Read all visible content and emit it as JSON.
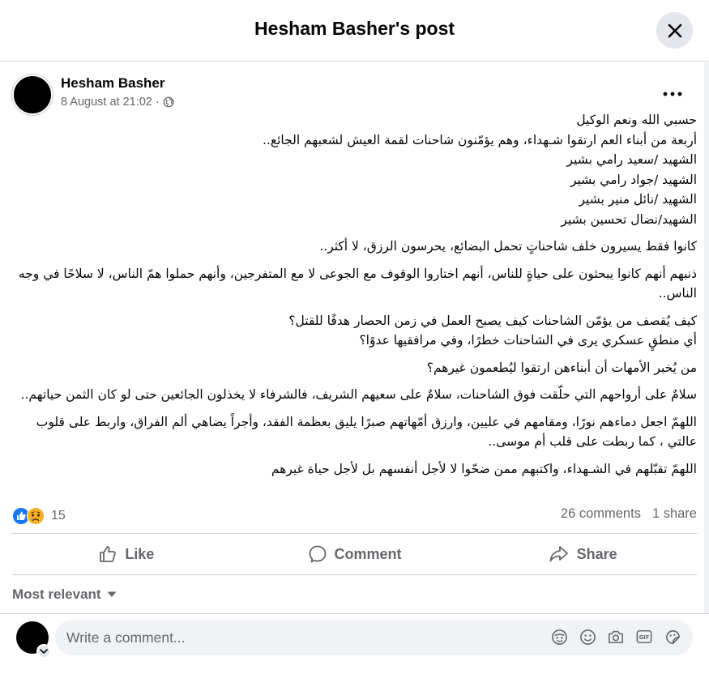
{
  "header": {
    "title": "Hesham Basher's post"
  },
  "post": {
    "author": "Hesham Basher",
    "timestamp": "8 August at 21:02",
    "separator": "·",
    "paragraphs": [
      "حسبي الله ونعم الوكيل\nأربعة من أبناء العم ارتقوا شـهداء، وهم يؤمّنون شاحنات لقمة العيش لشعبهم الجائع..\nالشهيد /سعيد رامي بشير\nالشهيد /جواد رامي بشير\nالشهيد /نائل منير بشير\nالشهيد/نضال تحسين بشير",
      "كانوا فقط يسيرون خلف شاحناتٍ تحمل البضائع، يحرسون الرزق، لا أكثر..",
      "ذنبهم أنهم كانوا يبحثون على حياةٍ للناس، أنهم اختاروا الوقوف مع الجوعى لا مع المتفرجين، وأنهم حملوا همّ الناس، لا سلاحًا في وجه الناس..",
      "كيف يُقصف من يؤمّن الشاحنات كيف يصبح العمل في زمن الحصار هدفًا للقتل؟\nأي منطقٍ عسكري يرى في الشاحنات خطرًا، وفي مرافقيها عدوًا؟",
      "من يُخبر الأمهات أن أبناءهن ارتقوا  ليُطعمون غيرهم؟",
      "سلامٌ على أرواحهم التي حلّقت فوق الشاحنات، سلامٌ على سعيهم الشريف، فالشرفاء لا يخذلون الجائعين حتى لو كان الثمن حياتهم..",
      "اللهمّ اجعل دماءهم نورًا، ومقامهم في عليين، وارزق أمّهاتهم صبرًا يليق بعظمة الفقد، وأجراً يضاهي ألم الفراق، واربط على قلوب عالتي ، كما ربطت على قلب أم موسى..",
      "اللهمّ تقبّلهم في الشـهداء، واكتبهم ممن ضحّوا لا لأجل أنفسهم بل لأجل حياة غيرهم"
    ]
  },
  "stats": {
    "reaction_count": "15",
    "comments": "26 comments",
    "shares": "1 share",
    "reaction_icons": [
      "like-icon",
      "sad-icon"
    ]
  },
  "actions": {
    "like": "Like",
    "comment": "Comment",
    "share": "Share"
  },
  "sort": {
    "label": "Most relevant"
  },
  "composer": {
    "placeholder": "Write a comment..."
  },
  "colors": {
    "like_blue": "#1877f2",
    "sad_yellow": "#f7b125",
    "muted": "#65676b",
    "button_bg": "#e4e6eb",
    "input_bg": "#f0f2f5"
  }
}
